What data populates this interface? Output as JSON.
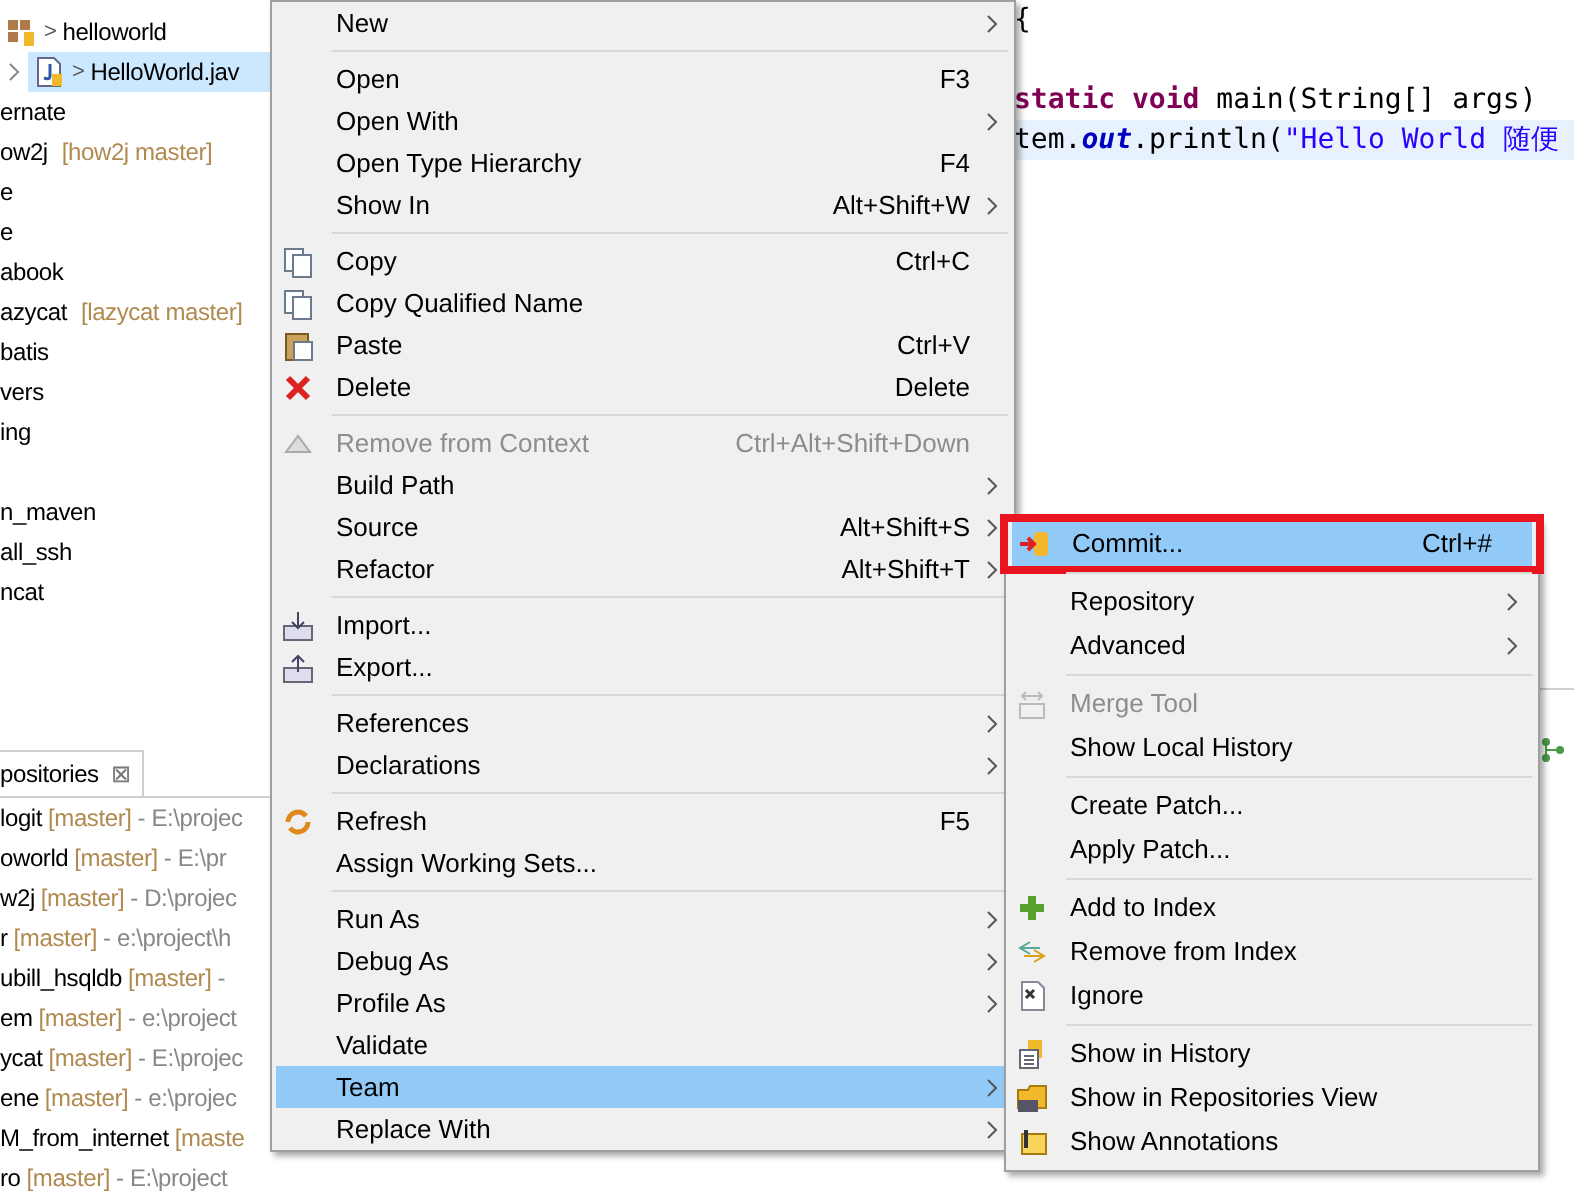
{
  "explorer": {
    "items": [
      {
        "text": "helloworld",
        "marker": ">",
        "chevron": false,
        "selected": false
      },
      {
        "text": "HelloWorld.jav",
        "marker": ">",
        "chevron": true,
        "selected": true
      },
      {
        "text": "ernate",
        "selected": false
      },
      {
        "text": "ow2j",
        "branch": "[how2j master]",
        "selected": false
      },
      {
        "text": "e",
        "selected": false
      },
      {
        "text": "e",
        "selected": false
      },
      {
        "text": "abook",
        "selected": false
      },
      {
        "text": "azycat",
        "branch": "[lazycat master]",
        "selected": false
      },
      {
        "text": "batis",
        "selected": false
      },
      {
        "text": "vers",
        "selected": false
      },
      {
        "text": "ing",
        "selected": false
      },
      {
        "selected": false
      },
      {
        "text": "n_maven",
        "selected": false
      },
      {
        "text": "all_ssh",
        "selected": false
      },
      {
        "text": "ncat",
        "selected": false
      }
    ]
  },
  "repositories": {
    "tab_label": "positories",
    "close": "⊠",
    "items": [
      {
        "name": "logit",
        "branch": "[master]",
        "path": "- E:\\projec"
      },
      {
        "name": "oworld",
        "branch": "[master]",
        "path": "- E:\\pr"
      },
      {
        "name": "w2j",
        "branch": "[master]",
        "path": "- D:\\projec"
      },
      {
        "name": "r",
        "branch": "[master]",
        "path": "- e:\\project\\h"
      },
      {
        "name": "ubill_hsqldb",
        "branch": "[master]",
        "path": "-"
      },
      {
        "name": "em",
        "branch": "[master]",
        "path": "- e:\\project"
      },
      {
        "name": "ycat",
        "branch": "[master]",
        "path": "- E:\\projec"
      },
      {
        "name": "ene",
        "branch": "[master]",
        "path": "- e:\\projec"
      },
      {
        "name": "M_from_internet",
        "branch": "[maste"
      },
      {
        "name": "ro",
        "branch": "[master]",
        "path": "- E:\\project"
      }
    ]
  },
  "editor": {
    "lines": [
      {
        "highlighted": false,
        "parts": [
          {
            "text": "{",
            "kind": "plain"
          }
        ]
      },
      {
        "highlighted": false
      },
      {
        "highlighted": false,
        "parts": [
          {
            "text": "static void",
            "kind": "keyword"
          },
          {
            "text": " main(String[] args)",
            "kind": "plain"
          }
        ]
      },
      {
        "highlighted": true,
        "parts": [
          {
            "text": "tem.",
            "kind": "plain"
          },
          {
            "text": "out",
            "kind": "field"
          },
          {
            "text": ".println(",
            "kind": "plain"
          },
          {
            "text": "\"Hello World 随便",
            "kind": "string"
          }
        ]
      }
    ]
  },
  "context_menu": {
    "items": [
      {
        "kind": "item",
        "label": "New",
        "submenu": true,
        "disabled": false,
        "selected": false
      },
      {
        "kind": "separator"
      },
      {
        "kind": "item",
        "label": "Open",
        "shortcut": "F3",
        "submenu": false,
        "disabled": false,
        "selected": false
      },
      {
        "kind": "item",
        "label": "Open With",
        "submenu": true,
        "disabled": false,
        "selected": false
      },
      {
        "kind": "item",
        "label": "Open Type Hierarchy",
        "shortcut": "F4",
        "submenu": false,
        "disabled": false,
        "selected": false
      },
      {
        "kind": "item",
        "label": "Show In",
        "shortcut": "Alt+Shift+W",
        "submenu": true,
        "disabled": false,
        "selected": false
      },
      {
        "kind": "separator"
      },
      {
        "kind": "item",
        "label": "Copy",
        "shortcut": "Ctrl+C",
        "submenu": false,
        "disabled": false,
        "selected": false
      },
      {
        "kind": "item",
        "label": "Copy Qualified Name",
        "submenu": false,
        "disabled": false,
        "selected": false
      },
      {
        "kind": "item",
        "label": "Paste",
        "shortcut": "Ctrl+V",
        "submenu": false,
        "disabled": false,
        "selected": false
      },
      {
        "kind": "item",
        "label": "Delete",
        "shortcut": "Delete",
        "submenu": false,
        "disabled": false,
        "selected": false
      },
      {
        "kind": "separator"
      },
      {
        "kind": "item",
        "label": "Remove from Context",
        "shortcut": "Ctrl+Alt+Shift+Down",
        "submenu": false,
        "disabled": true,
        "selected": false
      },
      {
        "kind": "item",
        "label": "Build Path",
        "submenu": true,
        "disabled": false,
        "selected": false
      },
      {
        "kind": "item",
        "label": "Source",
        "shortcut": "Alt+Shift+S",
        "submenu": true,
        "disabled": false,
        "selected": false
      },
      {
        "kind": "item",
        "label": "Refactor",
        "shortcut": "Alt+Shift+T",
        "submenu": true,
        "disabled": false,
        "selected": false
      },
      {
        "kind": "separator"
      },
      {
        "kind": "item",
        "label": "Import...",
        "submenu": false,
        "disabled": false,
        "selected": false
      },
      {
        "kind": "item",
        "label": "Export...",
        "submenu": false,
        "disabled": false,
        "selected": false
      },
      {
        "kind": "separator"
      },
      {
        "kind": "item",
        "label": "References",
        "submenu": true,
        "disabled": false,
        "selected": false
      },
      {
        "kind": "item",
        "label": "Declarations",
        "submenu": true,
        "disabled": false,
        "selected": false
      },
      {
        "kind": "separator"
      },
      {
        "kind": "item",
        "label": "Refresh",
        "shortcut": "F5",
        "submenu": false,
        "disabled": false,
        "selected": false
      },
      {
        "kind": "item",
        "label": "Assign Working Sets...",
        "submenu": false,
        "disabled": false,
        "selected": false
      },
      {
        "kind": "separator"
      },
      {
        "kind": "item",
        "label": "Run As",
        "submenu": true,
        "disabled": false,
        "selected": false
      },
      {
        "kind": "item",
        "label": "Debug As",
        "submenu": true,
        "disabled": false,
        "selected": false
      },
      {
        "kind": "item",
        "label": "Profile As",
        "submenu": true,
        "disabled": false,
        "selected": false
      },
      {
        "kind": "item",
        "label": "Validate",
        "submenu": false,
        "disabled": false,
        "selected": false
      },
      {
        "kind": "item",
        "label": "Team",
        "submenu": true,
        "disabled": false,
        "selected": true
      },
      {
        "kind": "item",
        "label": "Replace With",
        "submenu": true,
        "disabled": false,
        "selected": false
      }
    ]
  },
  "team_menu": {
    "items": [
      {
        "kind": "item",
        "label": "Commit...",
        "shortcut": "Ctrl+#",
        "submenu": false,
        "disabled": false,
        "selected": true,
        "outlined": true
      },
      {
        "kind": "separator"
      },
      {
        "kind": "item",
        "label": "Repository",
        "submenu": true,
        "disabled": false,
        "selected": false
      },
      {
        "kind": "item",
        "label": "Advanced",
        "submenu": true,
        "disabled": false,
        "selected": false
      },
      {
        "kind": "separator"
      },
      {
        "kind": "item",
        "label": "Merge Tool",
        "submenu": false,
        "disabled": true,
        "selected": false
      },
      {
        "kind": "item",
        "label": "Show Local History",
        "submenu": false,
        "disabled": false,
        "selected": false
      },
      {
        "kind": "separator"
      },
      {
        "kind": "item",
        "label": "Create Patch...",
        "submenu": false,
        "disabled": false,
        "selected": false
      },
      {
        "kind": "item",
        "label": "Apply Patch...",
        "submenu": false,
        "disabled": false,
        "selected": false
      },
      {
        "kind": "separator"
      },
      {
        "kind": "item",
        "label": "Add to Index",
        "submenu": false,
        "disabled": false,
        "selected": false
      },
      {
        "kind": "item",
        "label": "Remove from Index",
        "submenu": false,
        "disabled": false,
        "selected": false
      },
      {
        "kind": "item",
        "label": "Ignore",
        "submenu": false,
        "disabled": false,
        "selected": false
      },
      {
        "kind": "separator"
      },
      {
        "kind": "item",
        "label": "Show in History",
        "submenu": false,
        "disabled": false,
        "selected": false
      },
      {
        "kind": "item",
        "label": "Show in Repositories View",
        "submenu": false,
        "disabled": false,
        "selected": false
      },
      {
        "kind": "item",
        "label": "Show Annotations",
        "submenu": false,
        "disabled": false,
        "selected": false
      }
    ]
  }
}
